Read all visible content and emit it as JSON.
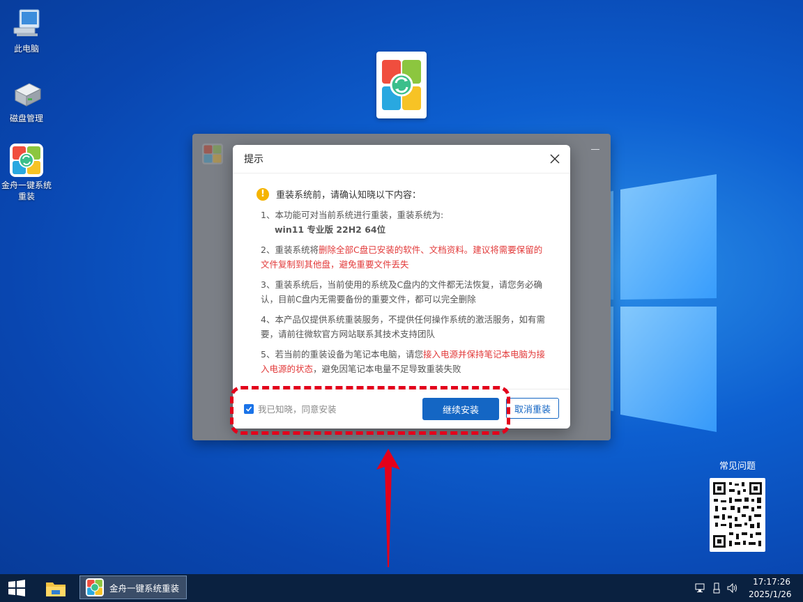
{
  "desktop": {
    "icons": [
      {
        "label": "此电脑"
      },
      {
        "label": "磁盘管理"
      },
      {
        "label": "金舟一键系统重装"
      }
    ]
  },
  "dialog": {
    "title": "提示",
    "warning": "重装系统前，请确认知晓以下内容：",
    "item1": {
      "text": "1、本功能可对当前系统进行重装，重装系统为:",
      "version": "win11 专业版 22H2 64位"
    },
    "item2": {
      "prefix": "2、重装系统将",
      "red": "删除全部C盘已安装的软件、文档资料。建议将需要保留的文件复制到其他盘，避免重要文件丢失"
    },
    "item3": {
      "text": "3、重装系统后，当前使用的系统及C盘内的文件都无法恢复，请您务必确认，目前C盘内无需要备份的重要文件，都可以完全删除"
    },
    "item4": {
      "text": "4、本产品仅提供系统重装服务，不提供任何操作系统的激活服务，如有需要，请前往微软官方网站联系其技术支持团队"
    },
    "item5": {
      "prefix": "5、若当前的重装设备为笔记本电脑，请您",
      "red": "接入电源并保持笔记本电脑为接入电源的状态",
      "suffix": "，避免因笔记本电量不足导致重装失败"
    },
    "agree_label": "我已知晓，同意安装",
    "agree_checked": true,
    "continue_label": "继续安装",
    "cancel_label": "取消重装"
  },
  "faq": {
    "label": "常见问题"
  },
  "taskbar": {
    "task_label": "金舟一键系统重装",
    "time": "17:17:26",
    "date": "2025/1/26"
  },
  "colors": {
    "accent": "#1466c4",
    "warning_red": "#e23a3a",
    "highlight_red": "#e3001b"
  }
}
